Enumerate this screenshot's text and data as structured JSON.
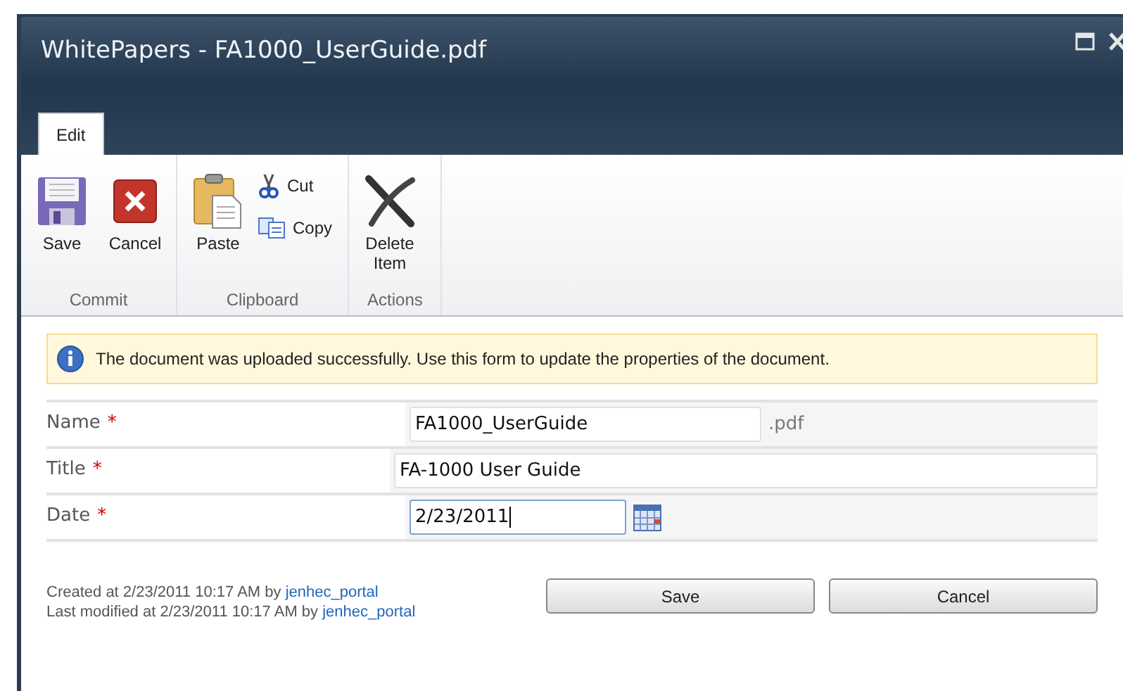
{
  "window": {
    "title": "WhitePapers - FA1000_UserGuide.pdf"
  },
  "tabs": [
    {
      "label": "Edit",
      "selected": true
    }
  ],
  "ribbon": {
    "groups": [
      {
        "label": "Commit",
        "buttons": [
          {
            "label": "Save",
            "kind": "large"
          },
          {
            "label": "Cancel",
            "kind": "large"
          }
        ]
      },
      {
        "label": "Clipboard",
        "buttons": [
          {
            "label": "Paste",
            "kind": "large"
          },
          {
            "label": "Cut",
            "kind": "small"
          },
          {
            "label": "Copy",
            "kind": "small"
          }
        ]
      },
      {
        "label": "Actions",
        "buttons": [
          {
            "label": "Delete Item",
            "kind": "large"
          }
        ]
      }
    ]
  },
  "message": "The document was uploaded successfully. Use this form to update the properties of the document.",
  "fields": [
    {
      "label": "Name",
      "required_mark": "*",
      "value": "FA1000_UserGuide",
      "suffix": ".pdf",
      "kind": "short",
      "focused": false
    },
    {
      "label": "Title",
      "required_mark": "*",
      "value": "FA-1000 User Guide",
      "kind": "wide",
      "focused": false
    },
    {
      "label": "Date",
      "required_mark": "*",
      "value": "2/23/2011",
      "kind": "date",
      "focused": true
    }
  ],
  "footer": [
    {
      "text": "Created at 2/23/2011 10:17 AM by ",
      "link": "jenhec_portal"
    },
    {
      "text": "Last modified at 2/23/2011 10:17 AM by ",
      "link": "jenhec_portal"
    }
  ],
  "buttons": [
    "Save",
    "Cancel"
  ]
}
